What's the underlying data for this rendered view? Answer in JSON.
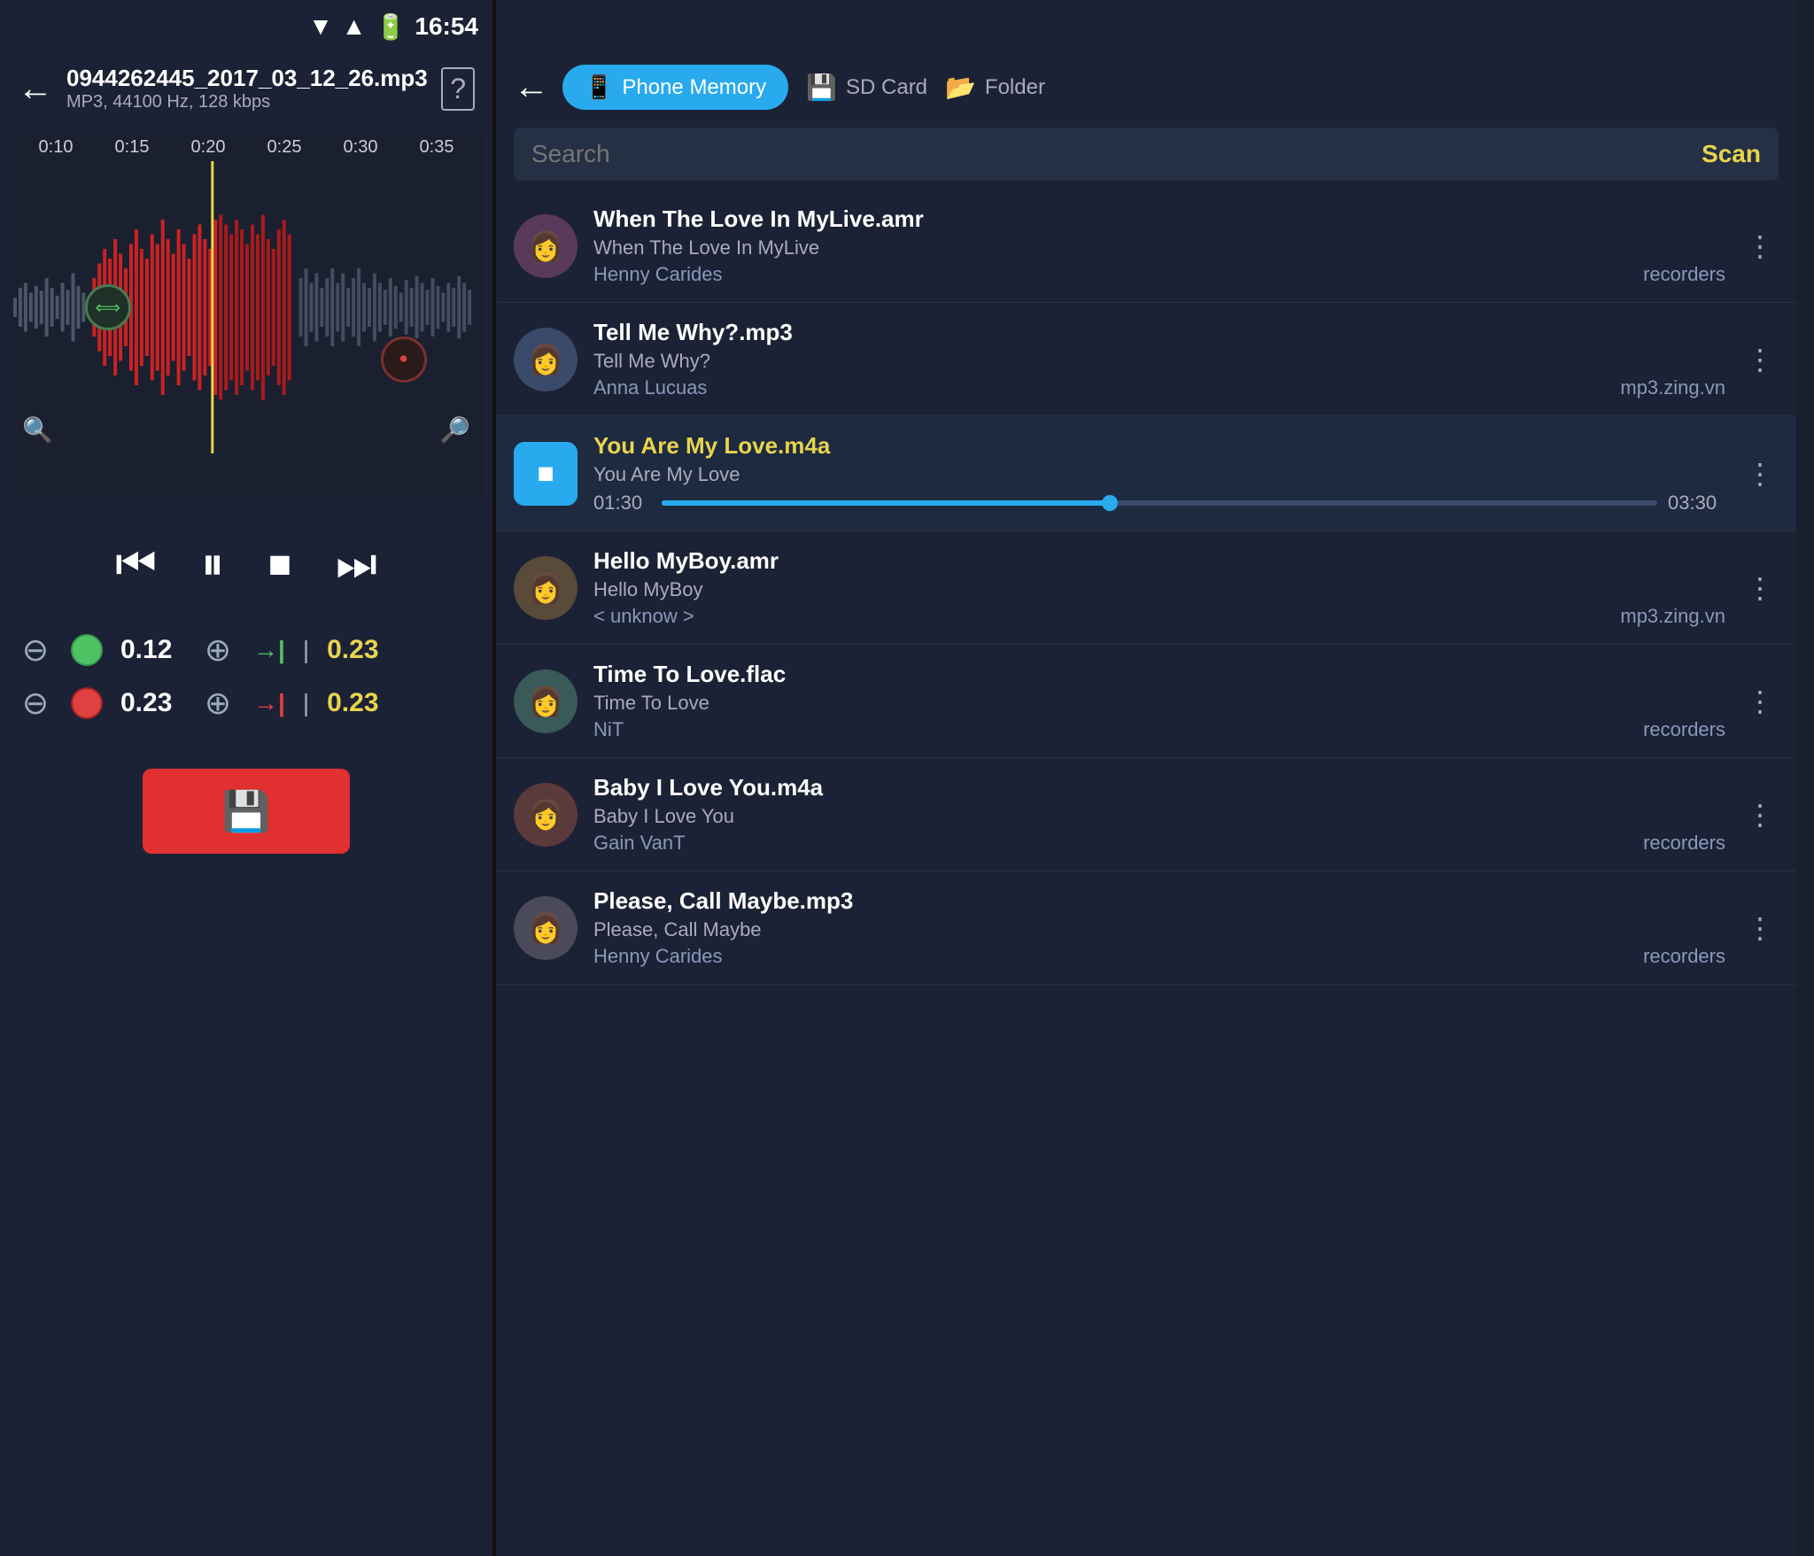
{
  "statusBar": {
    "time": "16:54"
  },
  "leftPanel": {
    "header": {
      "backLabel": "←",
      "fileName": "0944262445_2017_03_12_26.mp3",
      "fileMeta": "MP3, 44100 Hz, 128 kbps",
      "helpLabel": "?"
    },
    "timeline": {
      "marks": [
        "0:10",
        "0:15",
        "0:20",
        "0:25",
        "0:30",
        "0:35"
      ]
    },
    "playback": {
      "rewindLabel": "⏮",
      "pauseLabel": "⏸",
      "stopLabel": "⏹",
      "fastForwardLabel": "⏭"
    },
    "trim": {
      "row1": {
        "minus": "⊖",
        "plus": "⊕",
        "value": "0.12",
        "arrowLabel": "→|",
        "endValue": "0.23"
      },
      "row2": {
        "minus": "⊖",
        "plus": "⊕",
        "value": "0.23",
        "arrowLabel": "→|",
        "endValue": "0.23"
      }
    },
    "saveButton": {
      "label": "💾"
    }
  },
  "rightPanel": {
    "header": {
      "backLabel": "←",
      "tabs": {
        "phone": "Phone Memory",
        "sdCard": "SD Card",
        "folder": "Folder"
      }
    },
    "search": {
      "placeholder": "Search",
      "scanLabel": "Scan"
    },
    "songs": [
      {
        "id": 1,
        "title": "When The Love In MyLive.amr",
        "subtitle": "When The Love In MyLive",
        "artist": "Henny Carides",
        "source": "recorders",
        "active": false,
        "avatarColor": "av1"
      },
      {
        "id": 2,
        "title": "Tell Me Why?.mp3",
        "subtitle": "Tell Me Why?",
        "artist": "Anna Lucuas",
        "source": "mp3.zing.vn",
        "active": false,
        "avatarColor": "av2"
      },
      {
        "id": 3,
        "title": "You Are My Love.m4a",
        "subtitle": "You Are My Love",
        "artist": "",
        "source": "",
        "active": true,
        "currentTime": "01:30",
        "totalTime": "03:30",
        "avatarColor": "av3"
      },
      {
        "id": 4,
        "title": "Hello MyBoy.amr",
        "subtitle": "Hello MyBoy",
        "artist": "< unknow >",
        "source": "mp3.zing.vn",
        "active": false,
        "avatarColor": "av4"
      },
      {
        "id": 5,
        "title": "Time To Love.flac",
        "subtitle": "Time To Love",
        "artist": "NiT",
        "source": "recorders",
        "active": false,
        "avatarColor": "av5"
      },
      {
        "id": 6,
        "title": "Baby I Love You.m4a",
        "subtitle": "Baby I Love You",
        "artist": "Gain VanT",
        "source": "recorders",
        "active": false,
        "avatarColor": "av6"
      },
      {
        "id": 7,
        "title": "Please, Call Maybe.mp3",
        "subtitle": "Please, Call Maybe",
        "artist": "Henny Carides",
        "source": "recorders",
        "active": false,
        "avatarColor": "av7"
      }
    ]
  }
}
